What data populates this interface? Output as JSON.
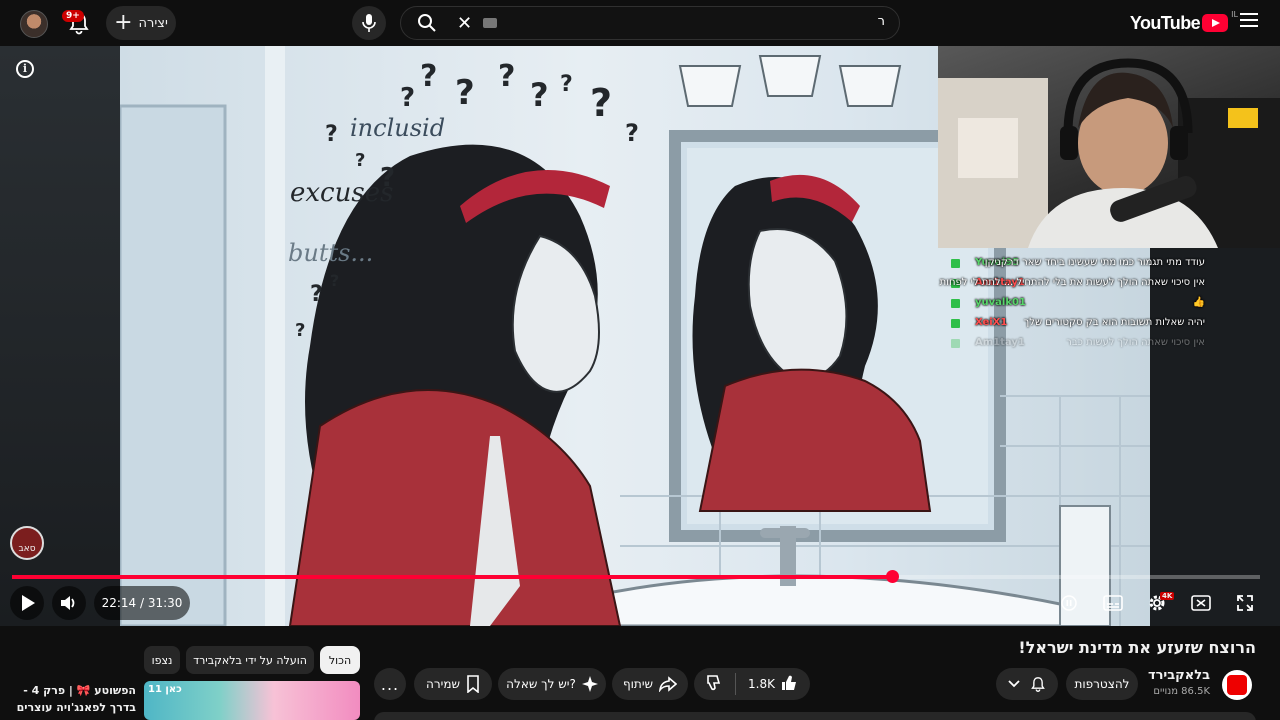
{
  "masthead": {
    "logo_text": "YouTube",
    "country_code": "IL",
    "search_value": "ר",
    "create_label": "יצירה",
    "notifications_badge": "9+"
  },
  "player": {
    "art_words": [
      "inclusid",
      "excuses",
      "butts..."
    ],
    "time_current": "22:14",
    "time_total": "31:30",
    "time_display": "22:14 / 31:30",
    "progress_fraction": 0.705,
    "quality_badge": "4K",
    "watermark_text": "סאב"
  },
  "chat": [
    {
      "user": "Yuval95",
      "message": "עודד מתי תגמור כמו מתי שעשינו ביחד שאר דרקניקן",
      "user_color": "#58d66a",
      "faded": false
    },
    {
      "user": "Am1tay1",
      "message": "אין סיכוי שאתה הולך לעשות את בלי להתחיל ... לתת לי לפחות",
      "user_color": "#ff4d4d",
      "faded": false
    },
    {
      "user": "yuvalk01",
      "message": "👍",
      "user_color": "#58d66a",
      "faded": false
    },
    {
      "user": "XeiX1",
      "message": "יהיה שאלות תשובות הוא בק סקטורים שלך",
      "user_color": "#ff4d4d",
      "faded": false
    },
    {
      "user": "Am1tay1",
      "message": "אין סיכוי שאתה הולך לעשות כבר",
      "user_color": "#bbbbbb",
      "faded": true
    }
  ],
  "video": {
    "title": "הרוצח שזעזע את מדינת ישראל!",
    "channel_name": "בלאקבירד",
    "subscribers": "86.5K מנויים",
    "join_label": "להצטרפות",
    "like_count": "1.8K",
    "share_label": "שיתוף",
    "ask_label": "יש לך שאלה?",
    "save_label": "שמירה",
    "more_label": "..."
  },
  "chips": {
    "all": "הכול",
    "uploaded_by": "הועלה על ידי בלאקבירד",
    "watched": "נצפו"
  },
  "recommendation": {
    "title_line1": "הפשוטע 🎀 | פרק 4 -",
    "title_line2": "בדרך לפאנג'ויה עוצרים",
    "logo": "כאן 11"
  },
  "colors": {
    "accent": "#ff0033",
    "background": "#0f0f0f",
    "button_bg": "#272727"
  }
}
